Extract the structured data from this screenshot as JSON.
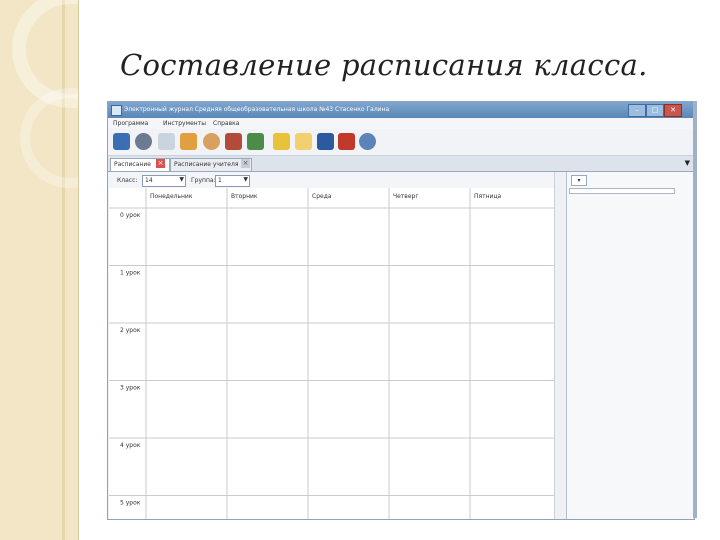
{
  "slide_title": "Составление расписания класса.",
  "window": {
    "title": "Электронный журнал   Средняя общеобразовательная школа №43   Стасенко Галина",
    "controls": [
      "–",
      "□",
      "✕"
    ]
  },
  "menu": [
    "Программа",
    "Инструменты",
    "Справка"
  ],
  "toolbar_icons": [
    {
      "name": "user-icon",
      "color": "#3a6fb5"
    },
    {
      "name": "clock-icon",
      "color": "#6b7c92"
    },
    {
      "name": "document-icon",
      "color": "#c9d4df"
    },
    {
      "name": "users-icon",
      "color": "#e0a040"
    },
    {
      "name": "person-icon",
      "color": "#d9a060"
    },
    {
      "name": "books-icon",
      "color": "#b34b3b"
    },
    {
      "name": "chalkboard-icon",
      "color": "#4d8b4a"
    },
    {
      "name": "pencil-icon",
      "color": "#e8c23a"
    },
    {
      "name": "envelope-icon",
      "color": "#f0d070"
    },
    {
      "name": "book-blue-icon",
      "color": "#2c5aa0"
    },
    {
      "name": "book-red-icon",
      "color": "#c0392b"
    },
    {
      "name": "globe-icon",
      "color": "#5c84b8"
    }
  ],
  "tabs": [
    {
      "label": "Расписание",
      "active": true
    },
    {
      "label": "Расписание учителя",
      "active": false
    }
  ],
  "filters": {
    "class_label": "Класс:",
    "class_value": "14",
    "group_label": "Группа:",
    "group_value": "1"
  },
  "schedule": {
    "days": [
      "Понедельник",
      "Вторник",
      "Среда",
      "Четверг",
      "Пятница"
    ],
    "lessons": [
      "0 урок",
      "1 урок",
      "2 урок",
      "3 урок",
      "4 урок",
      "5 урок"
    ]
  },
  "colors": {
    "accent": "#5a86b6",
    "sidebar": "#f2e6c6",
    "tab_close": "#d9534f"
  }
}
